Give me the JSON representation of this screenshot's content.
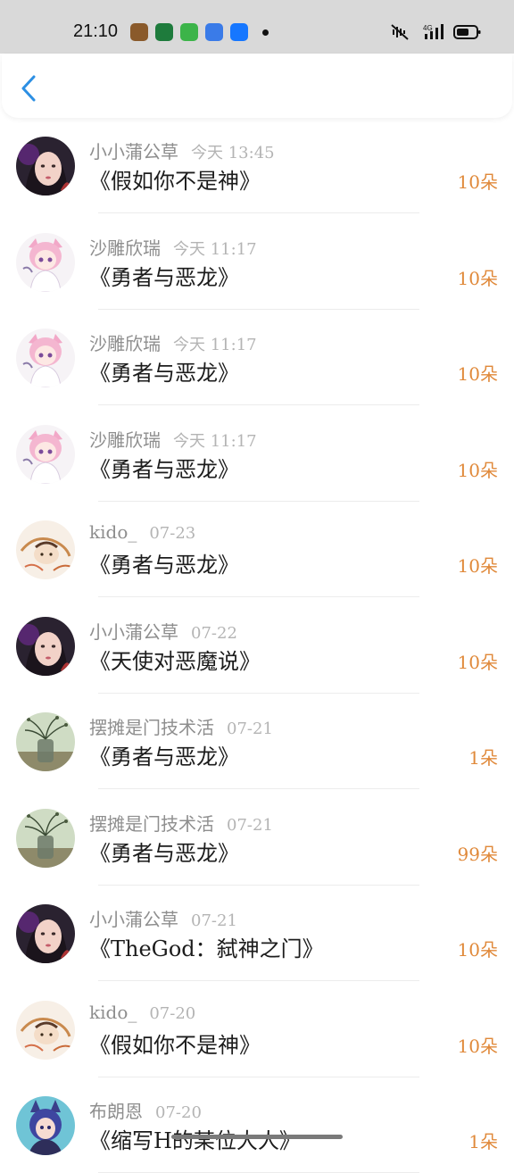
{
  "status_bar": {
    "time": "21:10",
    "app_icons": [
      {
        "name": "game-app-icon",
        "color": "#8a5a2b"
      },
      {
        "name": "oppo-app-icon",
        "color": "#1e7b3c"
      },
      {
        "name": "green-app-icon",
        "color": "#3cb449"
      },
      {
        "name": "cloud-app-icon",
        "color": "#3a7be8"
      },
      {
        "name": "alipay-app-icon",
        "color": "#1677ff"
      }
    ],
    "network": "4G"
  },
  "header": {
    "back_icon": "chevron-left-icon",
    "accent_color": "#2c8fe3"
  },
  "items": [
    {
      "name": "小小蒲公草",
      "date": "今天 13:45",
      "title": "《假如你不是神》",
      "amount": "10朵",
      "avatar": "girl-dark"
    },
    {
      "name": "沙雕欣瑞",
      "date": "今天 11:17",
      "title": "《勇者与恶龙》",
      "amount": "10朵",
      "avatar": "anime-pink"
    },
    {
      "name": "沙雕欣瑞",
      "date": "今天 11:17",
      "title": "《勇者与恶龙》",
      "amount": "10朵",
      "avatar": "anime-pink"
    },
    {
      "name": "沙雕欣瑞",
      "date": "今天 11:17",
      "title": "《勇者与恶龙》",
      "amount": "10朵",
      "avatar": "anime-pink"
    },
    {
      "name": "kido_",
      "date": "07-23",
      "title": "《勇者与恶龙》",
      "amount": "10朵",
      "avatar": "sketch"
    },
    {
      "name": "小小蒲公草",
      "date": "07-22",
      "title": "《天使对恶魔说》",
      "amount": "10朵",
      "avatar": "girl-dark"
    },
    {
      "name": "摆摊是门技术活",
      "date": "07-21",
      "title": "《勇者与恶龙》",
      "amount": "1朵",
      "avatar": "plant-vase"
    },
    {
      "name": "摆摊是门技术活",
      "date": "07-21",
      "title": "《勇者与恶龙》",
      "amount": "99朵",
      "avatar": "plant-vase"
    },
    {
      "name": "小小蒲公草",
      "date": "07-21",
      "title": "《TheGod：弑神之门》",
      "amount": "10朵",
      "avatar": "girl-dark"
    },
    {
      "name": "kido_",
      "date": "07-20",
      "title": "《假如你不是神》",
      "amount": "10朵",
      "avatar": "sketch"
    },
    {
      "name": "布朗恩",
      "date": "07-20",
      "title": "《缩写H的某位大人》",
      "amount": "1朵",
      "avatar": "anime-blue"
    }
  ],
  "colors": {
    "name": "#8e8e8e",
    "date": "#b4b4b4",
    "title": "#1c1c1c",
    "amount": "#e0893a"
  }
}
